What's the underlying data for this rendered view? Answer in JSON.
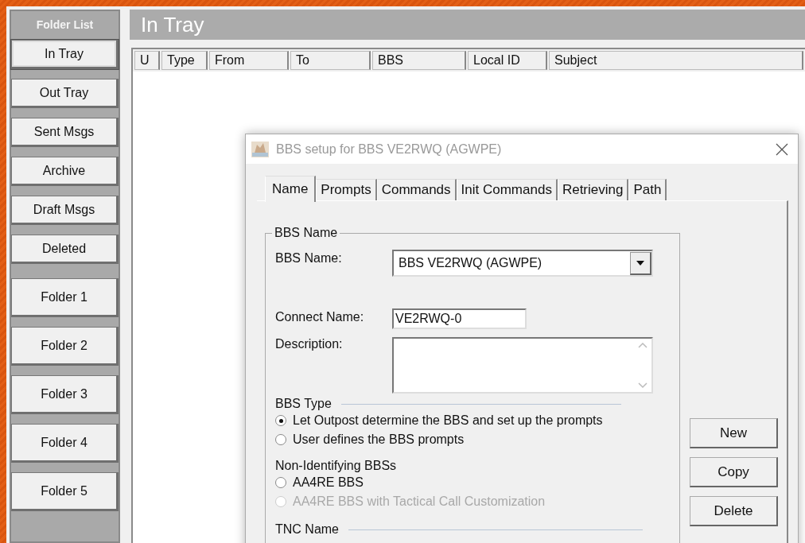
{
  "sidebar": {
    "title": "Folder List",
    "items": [
      {
        "label": "In Tray",
        "selected": true
      },
      {
        "label": "Out Tray",
        "selected": false
      },
      {
        "label": "Sent Msgs",
        "selected": false
      },
      {
        "label": "Archive",
        "selected": false
      },
      {
        "label": "Draft Msgs",
        "selected": false
      },
      {
        "label": "Deleted",
        "selected": false
      },
      {
        "label": "Folder 1",
        "selected": false,
        "kind": "tall"
      },
      {
        "label": "Folder 2",
        "selected": false,
        "kind": "tall"
      },
      {
        "label": "Folder 3",
        "selected": false,
        "kind": "tall"
      },
      {
        "label": "Folder 4",
        "selected": false,
        "kind": "tall"
      },
      {
        "label": "Folder 5",
        "selected": false,
        "kind": "tall"
      }
    ]
  },
  "header": {
    "title": "In Tray"
  },
  "table": {
    "columns": [
      "U",
      "Type",
      "From",
      "To",
      "BBS",
      "Local ID",
      "Subject"
    ]
  },
  "dialog": {
    "title": "BBS setup for BBS VE2RWQ (AGWPE)",
    "tabs": [
      {
        "label": "Name",
        "selected": true
      },
      {
        "label": "Prompts",
        "selected": false
      },
      {
        "label": "Commands",
        "selected": false
      },
      {
        "label": "Init Commands",
        "selected": false
      },
      {
        "label": "Retrieving",
        "selected": false
      },
      {
        "label": "Path",
        "selected": false
      }
    ],
    "group_title": "BBS Name",
    "bbs_name": {
      "label": "BBS Name:",
      "value": "BBS VE2RWQ (AGWPE)"
    },
    "connect_name": {
      "label": "Connect Name:",
      "value": "VE2RWQ-0"
    },
    "description": {
      "label": "Description:"
    },
    "bbs_type": {
      "title": "BBS Type",
      "options": [
        {
          "label": "Let Outpost determine the BBS and set up the prompts",
          "selected": true,
          "disabled": false
        },
        {
          "label": "User defines the BBS prompts",
          "selected": false,
          "disabled": false
        }
      ]
    },
    "non_identifying": {
      "title": "Non-Identifying BBSs",
      "options": [
        {
          "label": "AA4RE BBS",
          "selected": false,
          "disabled": false
        },
        {
          "label": "AA4RE BBS with Tactical Call Customization",
          "selected": false,
          "disabled": true
        }
      ]
    },
    "tnc_name": {
      "title": "TNC Name"
    },
    "buttons": [
      "New",
      "Copy",
      "Delete"
    ]
  }
}
